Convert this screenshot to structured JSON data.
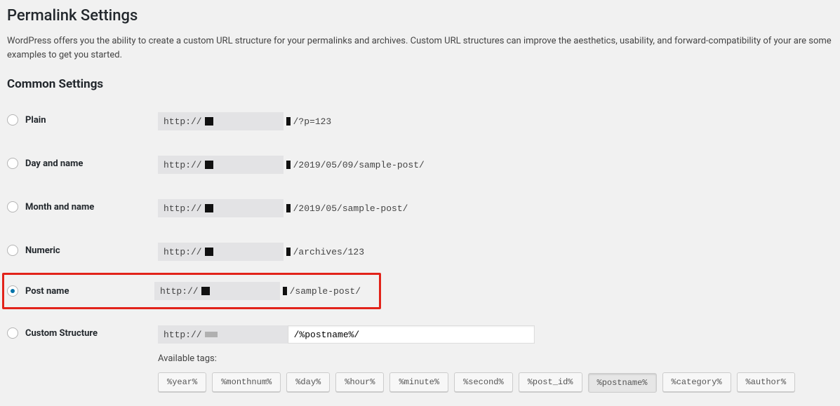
{
  "page": {
    "title": "Permalink Settings",
    "intro": "WordPress offers you the ability to create a custom URL structure for your permalinks and archives. Custom URL structures can improve the aesthetics, usability, and forward-compatibility of your are some examples to get you started."
  },
  "section_heading": "Common Settings",
  "protocol": "http://",
  "options": [
    {
      "key": "plain",
      "label": "Plain",
      "suffix": "/?p=123",
      "checked": false
    },
    {
      "key": "dayname",
      "label": "Day and name",
      "suffix": "/2019/05/09/sample-post/",
      "checked": false
    },
    {
      "key": "monthname",
      "label": "Month and name",
      "suffix": "/2019/05/sample-post/",
      "checked": false
    },
    {
      "key": "numeric",
      "label": "Numeric",
      "suffix": "/archives/123",
      "checked": false
    },
    {
      "key": "postname",
      "label": "Post name",
      "suffix": "/sample-post/",
      "checked": true
    }
  ],
  "custom": {
    "label": "Custom Structure",
    "value": "/%postname%/",
    "available_label": "Available tags:"
  },
  "tags": [
    {
      "text": "%year%",
      "active": false
    },
    {
      "text": "%monthnum%",
      "active": false
    },
    {
      "text": "%day%",
      "active": false
    },
    {
      "text": "%hour%",
      "active": false
    },
    {
      "text": "%minute%",
      "active": false
    },
    {
      "text": "%second%",
      "active": false
    },
    {
      "text": "%post_id%",
      "active": false
    },
    {
      "text": "%postname%",
      "active": true
    },
    {
      "text": "%category%",
      "active": false
    },
    {
      "text": "%author%",
      "active": false
    }
  ]
}
